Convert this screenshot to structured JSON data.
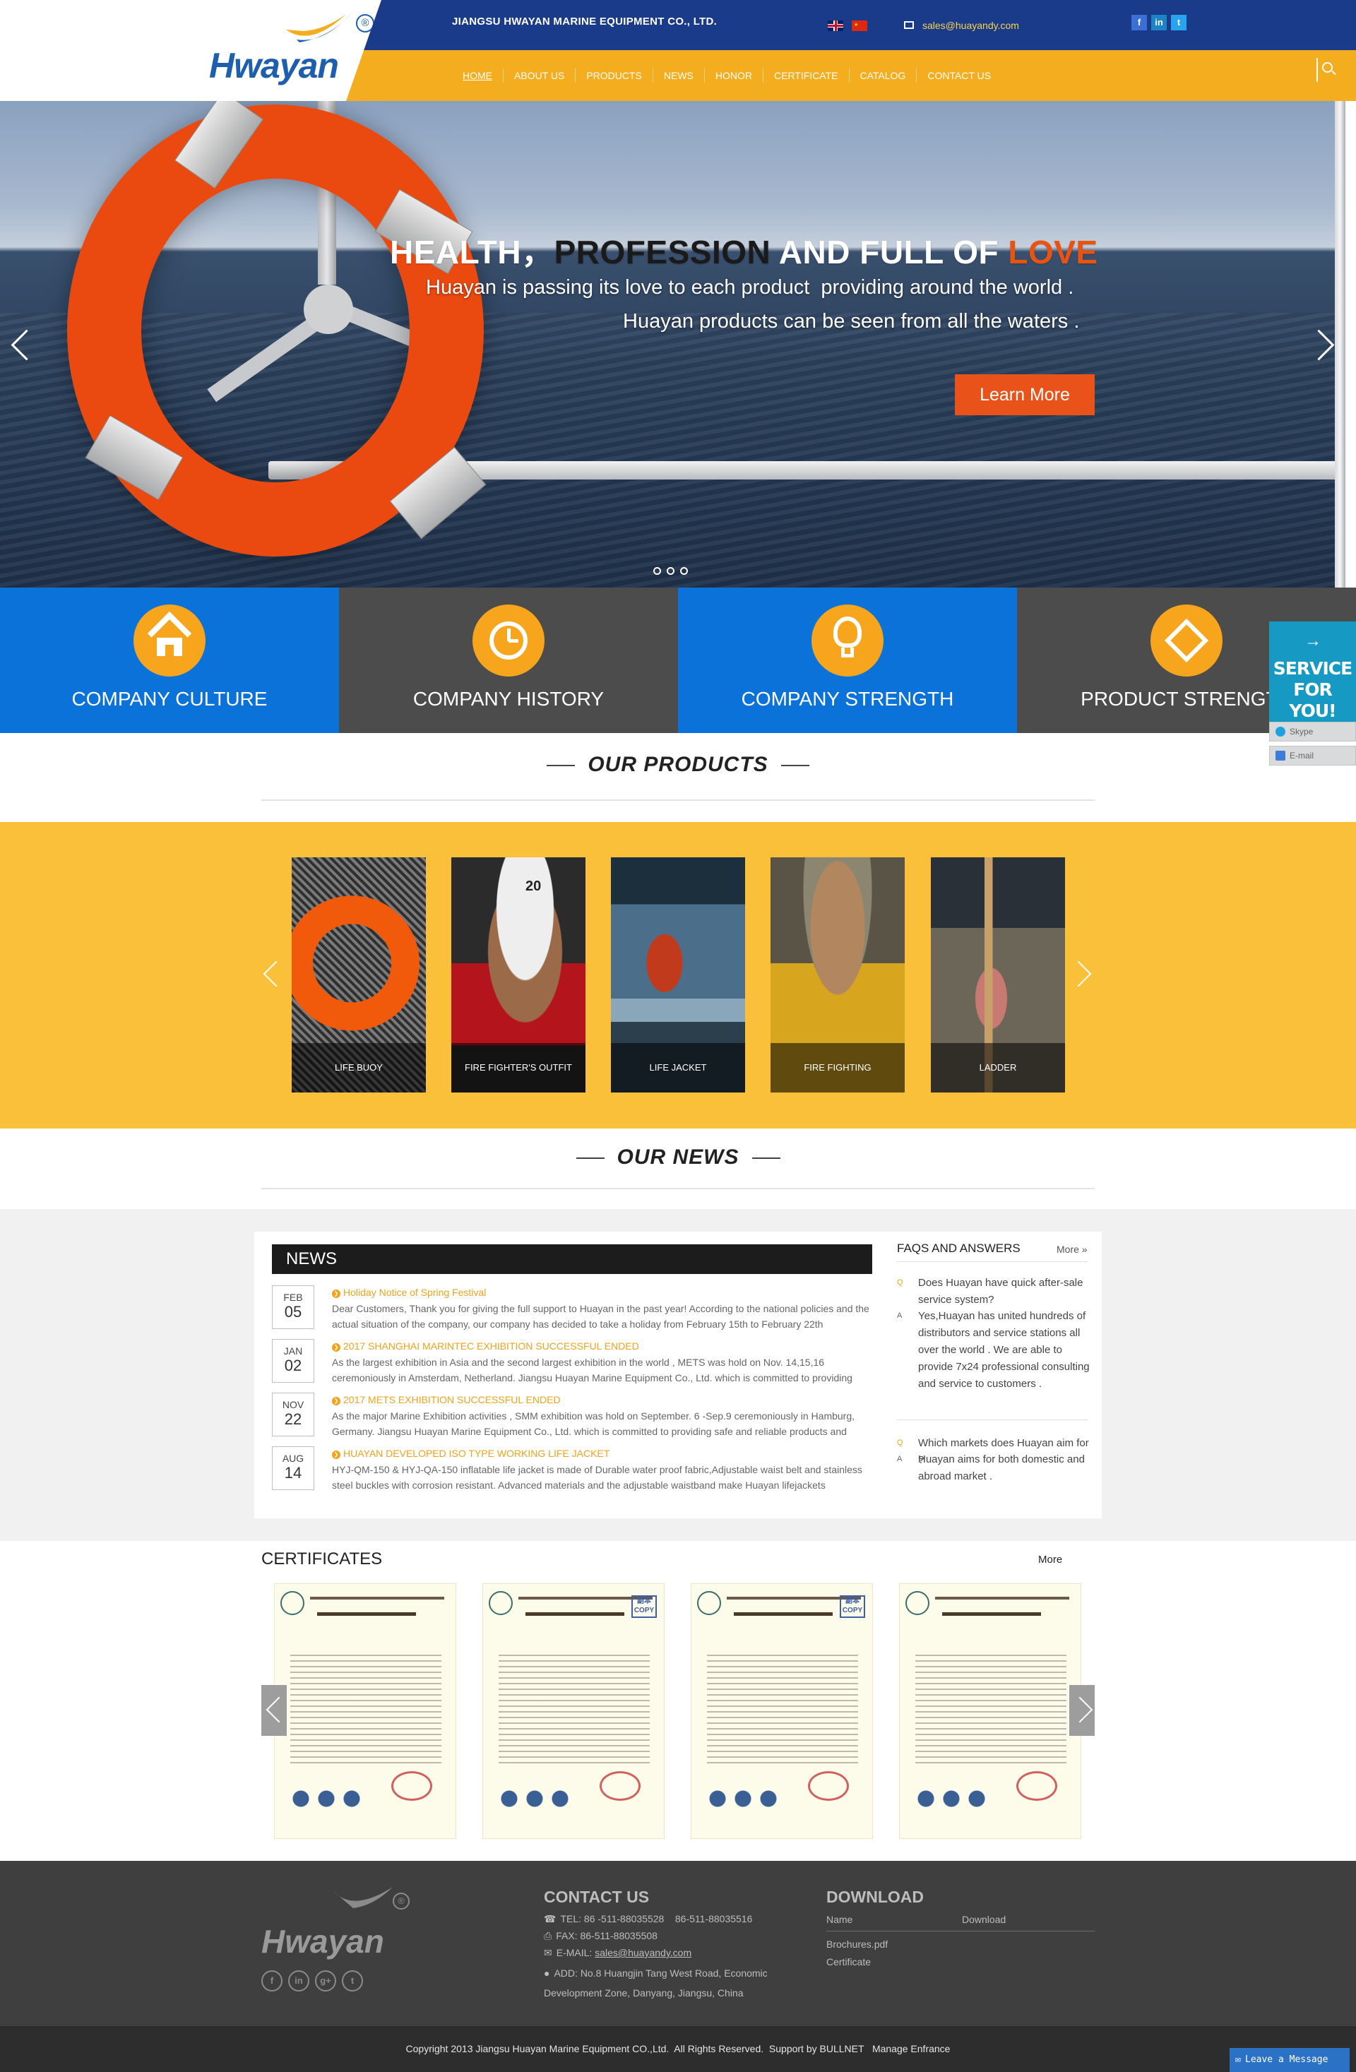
{
  "header": {
    "logo_text": "Hwayan",
    "logo_reg": "®",
    "company_name": "JIANGSU HWAYAN MARINE EQUIPMENT CO., LTD.",
    "email": "sales@huayandy.com",
    "social": [
      "f",
      "in",
      "t"
    ],
    "nav": [
      "HOME",
      "ABOUT US",
      "PRODUCTS",
      "NEWS",
      "HONOR",
      "CERTIFICATE",
      "CATALOG",
      "CONTACT US"
    ],
    "accent_blue": "#1a3a8a",
    "accent_yellow": "#f3ad1f"
  },
  "hero": {
    "title_part1": "HEALTH，",
    "title_part2": "PROFESSION",
    "title_part3": " AND FULL OF ",
    "title_part4": "LOVE",
    "line1": "Huayan is passing its love to each product  providing around the world .",
    "line2": "Huayan products can be seen from all the waters .",
    "cta": "Learn More",
    "cta_color": "#e9531a"
  },
  "features": [
    {
      "label": "COMPANY CULTURE",
      "icon": "home-icon"
    },
    {
      "label": "COMPANY HISTORY",
      "icon": "clock-icon"
    },
    {
      "label": "COMPANY STRENGTH",
      "icon": "lightbulb-icon"
    },
    {
      "label": "PRODUCT STRENGTH",
      "icon": "diamond-icon"
    }
  ],
  "service": {
    "arrow": "→",
    "title_line1": "SERVICE",
    "title_line2": "FOR YOU!",
    "skype": "Skype",
    "email": "E-mail"
  },
  "products": {
    "title": "OUR PRODUCTS",
    "items": [
      "LIFE BUOY",
      "FIRE FIGHTER'S OUTFIT",
      "LIFE JACKET",
      "FIRE FIGHTING",
      "LADDER"
    ]
  },
  "news_section": {
    "title": "OUR NEWS",
    "head": "NEWS",
    "items": [
      {
        "month": "FEB",
        "day": "05",
        "title": "Holiday Notice of Spring Festival",
        "text": "Dear Customers, Thank you for giving the full support to Huayan in the past year! According to the national policies and the actual situation of the company, our company has decided to take a holiday from February 15th to February 22th"
      },
      {
        "month": "JAN",
        "day": "02",
        "title": "2017 SHANGHAI MARINTEC EXHIBITION SUCCESSFUL ENDED",
        "text": "As the largest exhibition in Asia and the second largest exhibition in the world , METS was hold on Nov. 14,15,16 ceremoniously in Amsterdam, Netherland. Jiangsu Huayan Marine Equipment Co., Ltd. which is committed to providing"
      },
      {
        "month": "NOV",
        "day": "22",
        "title": "2017 METS EXHIBITION SUCCESSFUL ENDED",
        "text": "As the major Marine Exhibition activities , SMM exhibition was hold on September. 6 -Sep.9 ceremoniously in Hamburg, Germany. Jiangsu Huayan Marine Equipment Co., Ltd. which is committed to providing safe and reliable products and"
      },
      {
        "month": "AUG",
        "day": "14",
        "title": "HUAYAN DEVELOPED ISO TYPE WORKING LIFE JACKET",
        "text": "HYJ-QM-150 & HYJ-QA-150 inflatable life jacket is made of Durable water proof fabric,Adjustable waist belt and stainless steel buckles with corrosion resistant. Advanced materials and the adjustable waistband make Huayan lifejackets"
      }
    ]
  },
  "faq": {
    "title": "FAQS AND ANSWERS",
    "more": "More »",
    "q_mark": "Q",
    "a_mark": "A",
    "items": [
      {
        "q": "Does Huayan have quick after-sale service system?",
        "a": "Yes,Huayan has united hundreds of distributors and service stations all over the world . We are able to provide 7x24 professional consulting and service to customers ."
      },
      {
        "q": "Which markets does Huayan aim for ?",
        "a": "Huayan aims for both domestic and abroad market ."
      }
    ]
  },
  "certificates": {
    "title": "CERTIFICATES",
    "more": "More",
    "copy_label": "副本 COPY"
  },
  "footer": {
    "logo_text": "Hwayan",
    "logo_reg": "®",
    "social": [
      "f",
      "in",
      "g+",
      "t"
    ],
    "contact_title": "CONTACT US",
    "tel_label": "TEL:",
    "tel": "86 -511-88035528    86-511-88035516",
    "fax_label": "FAX:",
    "fax": "86-511-88035508",
    "email_label": "E-MAIL:",
    "email": "sales@huayandy.com",
    "add_label": "ADD:",
    "address_line1": "No.8 Huangjin Tang West Road, Economic",
    "address_line2": "Development Zone, Danyang, Jiangsu, China",
    "download_title": "DOWNLOAD",
    "col_name": "Name",
    "col_download": "Download",
    "downloads": [
      "Brochures.pdf",
      "Certificate"
    ],
    "copyright": "Copyright 2013 Jiangsu Huayan Marine Equipment CO.,Ltd.  All Rights Reserved.  Support by BULLNET   Manage Enfrance",
    "leave_message": "Leave a Message"
  }
}
